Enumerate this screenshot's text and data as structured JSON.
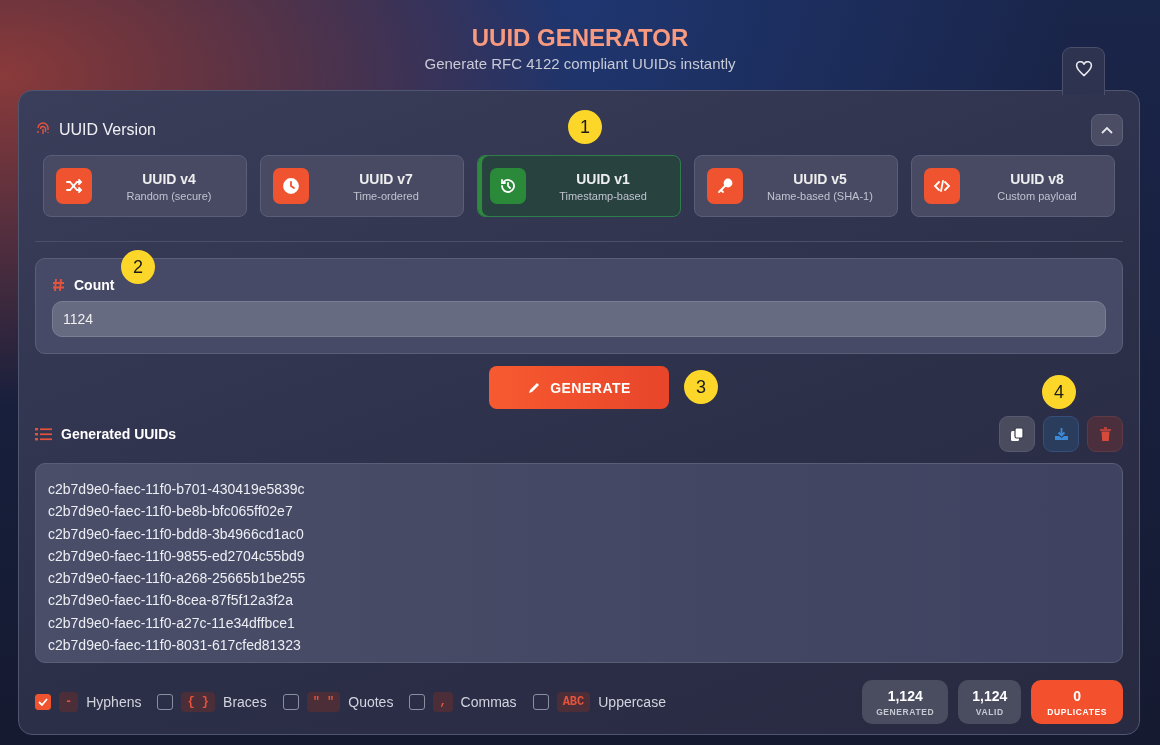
{
  "header": {
    "title": "UUID GENERATOR",
    "subtitle": "Generate RFC 4122 compliant UUIDs instantly"
  },
  "version_section": {
    "title": "UUID Version",
    "expanded": true,
    "versions": [
      {
        "name": "UUID v4",
        "description": "Random (secure)",
        "selected": false
      },
      {
        "name": "UUID v7",
        "description": "Time-ordered",
        "selected": false
      },
      {
        "name": "UUID v1",
        "description": "Timestamp-based",
        "selected": true
      },
      {
        "name": "UUID v5",
        "description": "Name-based (SHA-1)",
        "selected": false
      },
      {
        "name": "UUID v8",
        "description": "Custom payload",
        "selected": false
      }
    ]
  },
  "count": {
    "label": "Count",
    "value": "1124"
  },
  "generate_button": "GENERATE",
  "output": {
    "title": "Generated UUIDs",
    "lines": [
      "c2b7d9e0-faec-11f0-b701-430419e5839c",
      "c2b7d9e0-faec-11f0-be8b-bfc065ff02e7",
      "c2b7d9e0-faec-11f0-bdd8-3b4966cd1ac0",
      "c2b7d9e0-faec-11f0-9855-ed2704c55bd9",
      "c2b7d9e0-faec-11f0-a268-25665b1be255",
      "c2b7d9e0-faec-11f0-8cea-87f5f12a3f2a",
      "c2b7d9e0-faec-11f0-a27c-11e34dffbce1",
      "c2b7d9e0-faec-11f0-8031-617cfed81323"
    ]
  },
  "options": [
    {
      "tag": "-",
      "label": "Hyphens",
      "checked": true
    },
    {
      "tag": "{ }",
      "label": "Braces",
      "checked": false
    },
    {
      "tag": "\" \"",
      "label": "Quotes",
      "checked": false
    },
    {
      "tag": ",",
      "label": "Commas",
      "checked": false
    },
    {
      "tag": "ABC",
      "label": "Uppercase",
      "checked": false
    }
  ],
  "stats": [
    {
      "value": "1,124",
      "label": "GENERATED",
      "highlighted": false
    },
    {
      "value": "1,124",
      "label": "VALID",
      "highlighted": false
    },
    {
      "value": "0",
      "label": "DUPLICATES",
      "highlighted": true
    }
  ],
  "callouts": [
    "1",
    "2",
    "3",
    "4"
  ]
}
